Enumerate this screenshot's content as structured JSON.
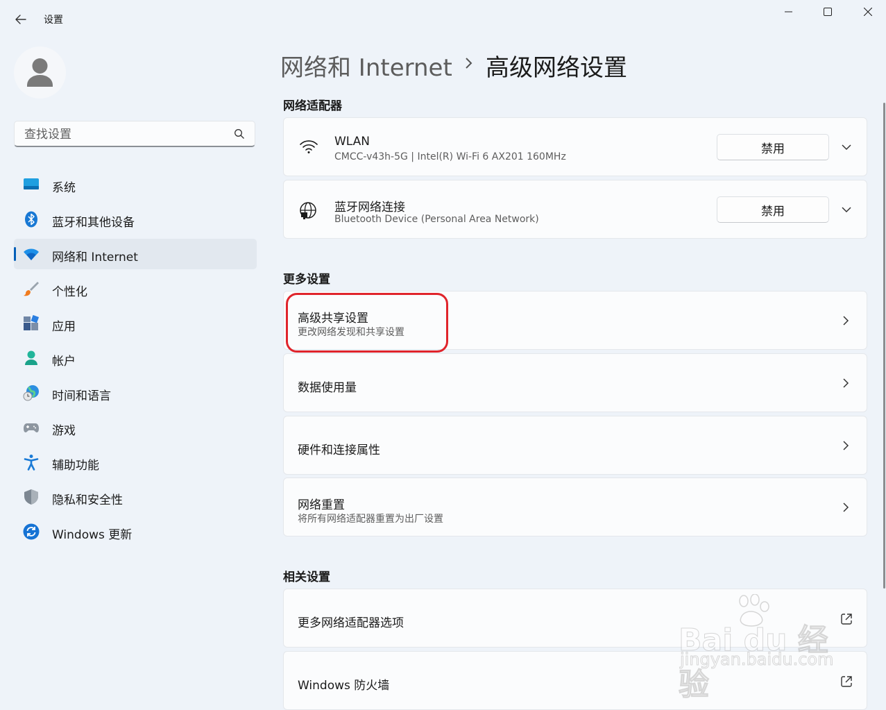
{
  "titlebar": {
    "app_title": "设置"
  },
  "sidebar": {
    "search_placeholder": "查找设置",
    "items": [
      {
        "label": "系统"
      },
      {
        "label": "蓝牙和其他设备"
      },
      {
        "label": "网络和 Internet",
        "selected": true
      },
      {
        "label": "个性化"
      },
      {
        "label": "应用"
      },
      {
        "label": "帐户"
      },
      {
        "label": "时间和语言"
      },
      {
        "label": "游戏"
      },
      {
        "label": "辅助功能"
      },
      {
        "label": "隐私和安全性"
      },
      {
        "label": "Windows 更新"
      }
    ]
  },
  "breadcrumb": {
    "parent": "网络和 Internet",
    "separator": "›",
    "current": "高级网络设置"
  },
  "sections": {
    "adapters": "网络适配器",
    "more": "更多设置",
    "related": "相关设置"
  },
  "adapters": [
    {
      "name": "WLAN",
      "detail": "CMCC-v43h-5G | Intel(R) Wi-Fi 6 AX201 160MHz",
      "button": "禁用",
      "icon": "wifi-icon"
    },
    {
      "name": "蓝牙网络连接",
      "detail": "Bluetooth Device (Personal Area Network)",
      "button": "禁用",
      "icon": "network-globe-icon"
    }
  ],
  "more_settings": [
    {
      "title": "高级共享设置",
      "subtitle": "更改网络发现和共享设置"
    },
    {
      "title": "数据使用量"
    },
    {
      "title": "硬件和连接属性"
    },
    {
      "title": "网络重置",
      "subtitle": "将所有网络适配器重置为出厂设置"
    }
  ],
  "related_settings": [
    {
      "title": "更多网络适配器选项"
    },
    {
      "title": "Windows 防火墙"
    }
  ],
  "watermark": {
    "brand": "Bai du 经验",
    "url": "jingyan.baidu.com"
  },
  "colors": {
    "accent": "#005fb8",
    "highlight": "#e0242b",
    "background": "#eef3f9",
    "card": "#fbfcfd"
  }
}
